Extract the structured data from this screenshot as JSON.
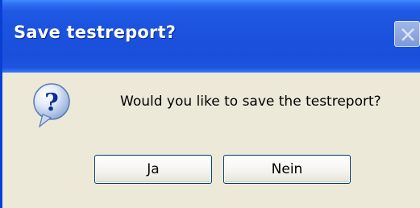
{
  "dialog": {
    "title": "Save testreport?",
    "message": "Would you like to save the testreport?",
    "icon": "question-icon",
    "buttons": {
      "yes_label": "Ja",
      "no_label": "Nein"
    }
  },
  "colors": {
    "titlebar": "#1b52de",
    "window_background": "#ece9d8",
    "button_border": "#003c74"
  }
}
